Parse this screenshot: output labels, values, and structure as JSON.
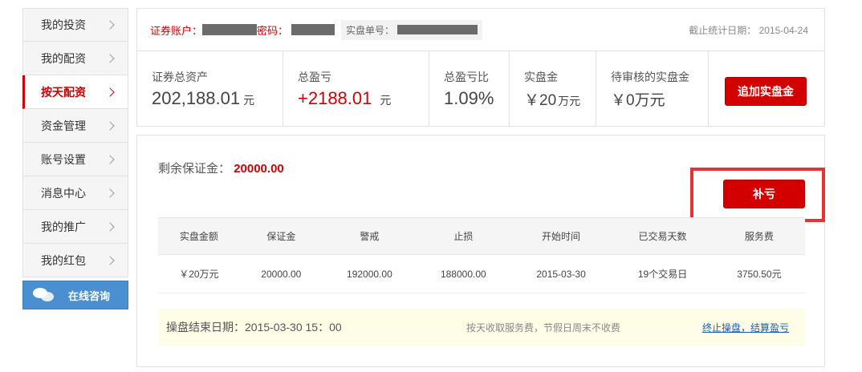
{
  "sidebar": {
    "items": [
      {
        "label": "我的投资"
      },
      {
        "label": "我的配资"
      },
      {
        "label": "按天配资"
      },
      {
        "label": "资金管理"
      },
      {
        "label": "账号设置"
      },
      {
        "label": "消息中心"
      },
      {
        "label": "我的推广"
      },
      {
        "label": "我的红包"
      }
    ],
    "active_index": 2,
    "consult_label": "在线咨询"
  },
  "topbar": {
    "account_label": "证券账户：",
    "password_label": "密码：",
    "order_label": "实盘单号：",
    "date_label": "截止统计日期：",
    "date_value": "2015-04-24"
  },
  "stats": {
    "total_assets": {
      "title": "证券总资产",
      "value": "202,188.01",
      "unit": "元"
    },
    "total_pnl": {
      "title": "总盈亏",
      "value": "+2188.01",
      "unit": "元"
    },
    "pnl_ratio": {
      "title": "总盈亏比",
      "value": "1.09%"
    },
    "real_fund": {
      "title": "实盘金",
      "value": "￥20",
      "unit": "万元"
    },
    "pending_fund": {
      "title": "待审核的实盘金",
      "value": "￥0万元"
    },
    "add_button": "追加实盘金"
  },
  "main": {
    "margin_label": "剩余保证金：",
    "margin_value": "20000.00",
    "buku_button": "补亏",
    "table": {
      "headers": [
        "实盘金额",
        "保证金",
        "警戒",
        "止损",
        "开始时间",
        "已交易天数",
        "服务费"
      ],
      "row": [
        "￥20万元",
        "20000.00",
        "192000.00",
        "188000.00",
        "2015-03-30",
        "19个交易日",
        "3750.50元"
      ]
    },
    "end_date_label": "操盘结束日期：2015-03-30 15：00",
    "fee_note": "按天收取服务费，节假日周末不收费",
    "terminate_link": "终止操盘，结算盈亏"
  },
  "colors": {
    "accent_red": "#d20000",
    "highlight_red": "#e53333",
    "consult_blue": "#4a8fd0"
  }
}
